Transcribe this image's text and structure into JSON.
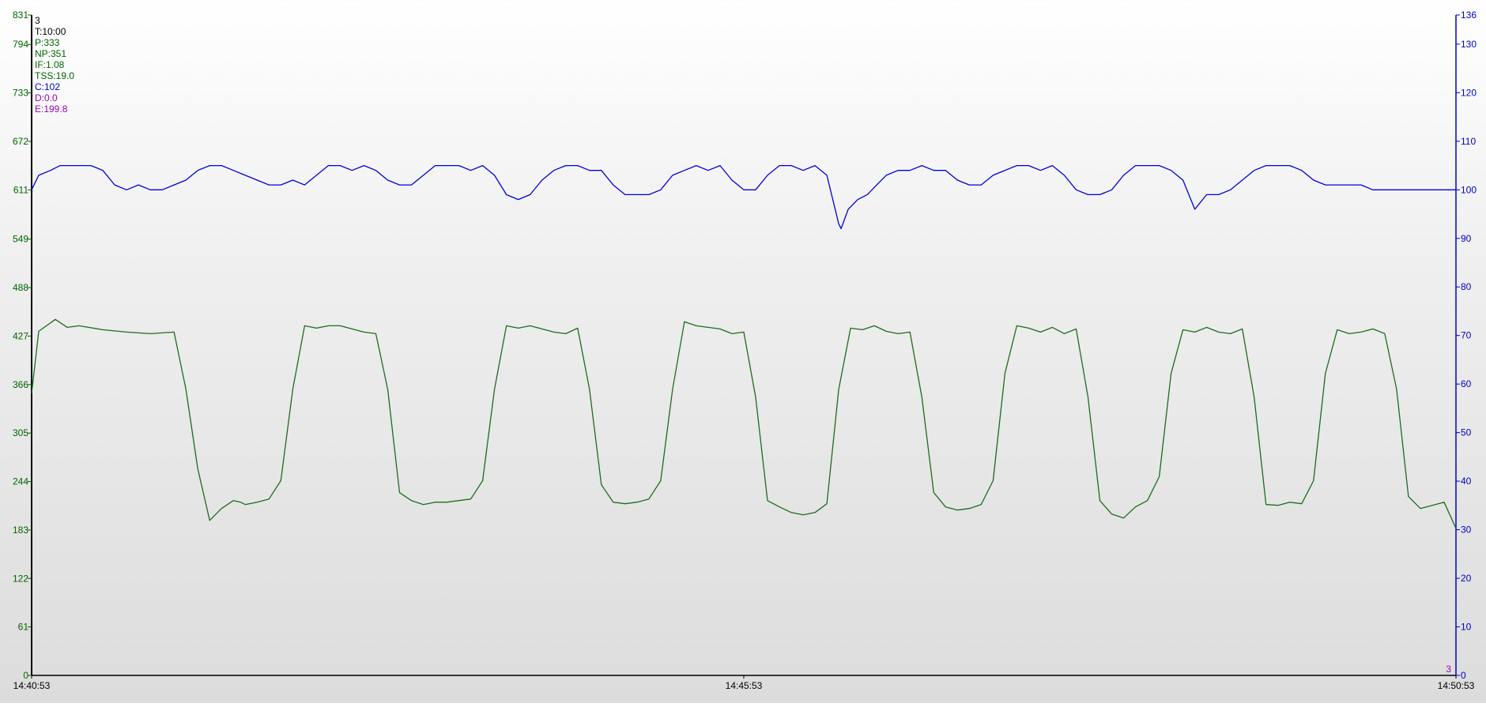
{
  "chart_data": {
    "type": "line",
    "lap_number": "3",
    "x_ticks": [
      "14:40:53",
      "14:45:53",
      "14:50:53"
    ],
    "x_range": [
      "14:40:53",
      "14:50:53"
    ],
    "y_left": {
      "ylim": [
        0,
        831
      ],
      "ticks": [
        0,
        61,
        122,
        183,
        244,
        305,
        366,
        427,
        488,
        549,
        611,
        672,
        733,
        794,
        831
      ],
      "color": "#006400"
    },
    "y_right": {
      "ylim": [
        0,
        136
      ],
      "ticks": [
        0,
        10,
        20,
        30,
        40,
        50,
        60,
        70,
        80,
        90,
        100,
        110,
        120,
        130,
        136
      ],
      "color": "#0000cc"
    },
    "stats": [
      {
        "text": "3",
        "color": "#000000"
      },
      {
        "text": "T:10:00",
        "color": "#000000"
      },
      {
        "text": "P:333",
        "color": "#006400"
      },
      {
        "text": "NP:351",
        "color": "#006400"
      },
      {
        "text": "IF:1.08",
        "color": "#006400"
      },
      {
        "text": "TSS:19.0",
        "color": "#006400"
      },
      {
        "text": "C:102",
        "color": "#0000cc"
      },
      {
        "text": "D:0.0",
        "color": "#a000c0"
      },
      {
        "text": "E:199.8",
        "color": "#a000c0"
      }
    ],
    "corner_label": {
      "text": "3",
      "color": "#a000c0"
    },
    "series": [
      {
        "axis": "left",
        "color": "#1f6b1f",
        "x": [
          0,
          3,
          10,
          15,
          20,
          30,
          40,
          50,
          60,
          65,
          70,
          75,
          80,
          85,
          88,
          90,
          95,
          100,
          105,
          110,
          115,
          120,
          125,
          130,
          135,
          140,
          145,
          150,
          155,
          160,
          165,
          170,
          175,
          180,
          185,
          190,
          195,
          200,
          205,
          210,
          215,
          220,
          225,
          230,
          235,
          240,
          245,
          250,
          255,
          260,
          265,
          270,
          275,
          280,
          285,
          290,
          295,
          300,
          305,
          310,
          315,
          320,
          325,
          330,
          335,
          340,
          345,
          350,
          355,
          360,
          365,
          370,
          375,
          380,
          385,
          390,
          395,
          400,
          405,
          410,
          415,
          420,
          425,
          430,
          435,
          440,
          445,
          450,
          455,
          460,
          465,
          470,
          475,
          480,
          485,
          490,
          495,
          500,
          505,
          510,
          515,
          520,
          525,
          530,
          535,
          540,
          545,
          550,
          555,
          560,
          565,
          570,
          575,
          580,
          585,
          590,
          595,
          600
        ],
        "values": [
          355,
          433,
          448,
          438,
          440,
          435,
          432,
          430,
          432,
          360,
          260,
          195,
          210,
          220,
          218,
          215,
          218,
          222,
          245,
          360,
          440,
          437,
          440,
          440,
          436,
          432,
          430,
          360,
          230,
          220,
          215,
          218,
          218,
          220,
          222,
          245,
          360,
          440,
          437,
          440,
          436,
          432,
          430,
          437,
          360,
          240,
          218,
          216,
          218,
          222,
          245,
          360,
          445,
          440,
          438,
          436,
          430,
          432,
          350,
          220,
          212,
          205,
          202,
          205,
          216,
          360,
          437,
          435,
          440,
          433,
          430,
          432,
          350,
          230,
          212,
          208,
          210,
          215,
          245,
          380,
          440,
          437,
          432,
          438,
          430,
          436,
          350,
          220,
          203,
          198,
          212,
          220,
          250,
          380,
          435,
          432,
          438,
          432,
          430,
          436,
          350,
          215,
          214,
          218,
          216,
          245,
          380,
          435,
          430,
          432,
          436,
          430,
          360,
          225,
          210,
          214,
          218,
          185
        ]
      },
      {
        "axis": "right",
        "color": "#0000dd",
        "x": [
          0,
          3,
          8,
          12,
          18,
          25,
          30,
          35,
          40,
          45,
          50,
          55,
          60,
          65,
          70,
          75,
          80,
          85,
          90,
          95,
          100,
          105,
          110,
          115,
          120,
          125,
          130,
          135,
          140,
          145,
          150,
          155,
          160,
          165,
          170,
          175,
          180,
          185,
          190,
          195,
          200,
          205,
          210,
          215,
          220,
          225,
          230,
          235,
          240,
          245,
          250,
          255,
          260,
          265,
          270,
          275,
          280,
          285,
          290,
          295,
          300,
          305,
          310,
          315,
          320,
          325,
          330,
          335,
          340,
          341,
          344,
          348,
          352,
          356,
          360,
          365,
          370,
          375,
          380,
          385,
          390,
          395,
          400,
          405,
          410,
          415,
          420,
          425,
          430,
          435,
          440,
          445,
          450,
          455,
          460,
          465,
          470,
          475,
          480,
          485,
          490,
          495,
          500,
          505,
          510,
          515,
          520,
          525,
          530,
          535,
          540,
          545,
          550,
          555,
          560,
          565,
          570,
          575,
          580,
          585,
          590,
          595,
          600
        ],
        "values": [
          100,
          103,
          104,
          105,
          105,
          105,
          104,
          101,
          100,
          101,
          100,
          100,
          101,
          102,
          104,
          105,
          105,
          104,
          103,
          102,
          101,
          101,
          102,
          101,
          103,
          105,
          105,
          104,
          105,
          104,
          102,
          101,
          101,
          103,
          105,
          105,
          105,
          104,
          105,
          103,
          99,
          98,
          99,
          102,
          104,
          105,
          105,
          104,
          104,
          101,
          99,
          99,
          99,
          100,
          103,
          104,
          105,
          104,
          105,
          102,
          100,
          100,
          103,
          105,
          105,
          104,
          105,
          103,
          93,
          92,
          96,
          98,
          99,
          101,
          103,
          104,
          104,
          105,
          104,
          104,
          102,
          101,
          101,
          103,
          104,
          105,
          105,
          104,
          105,
          103,
          100,
          99,
          99,
          100,
          103,
          105,
          105,
          105,
          104,
          102,
          96,
          99,
          99,
          100,
          102,
          104,
          105,
          105,
          105,
          104,
          102,
          101,
          101,
          101,
          101,
          100,
          100,
          100,
          100,
          100,
          100,
          100,
          100
        ]
      }
    ]
  }
}
